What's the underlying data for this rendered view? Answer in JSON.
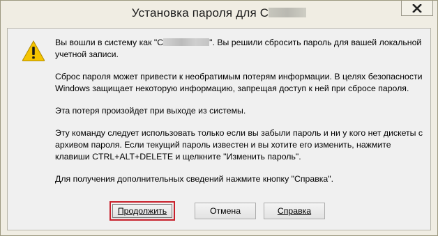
{
  "window": {
    "title": "Установка пароля для С"
  },
  "message": {
    "p1_before": "Вы вошли в систему как \"С",
    "p1_after": "\". Вы решили сбросить пароль для вашей локальной учетной записи.",
    "p2": "Сброс пароля может привести к необратимым потерям информации. В целях безопасности Windows защищает некоторую информацию, запрещая доступ к ней при сбросе пароля.",
    "p3": "Эта потеря произойдет при выходе из системы.",
    "p4": "Эту команду следует использовать только если вы забыли пароль и ни у кого нет дискеты с архивом пароля. Если текущий пароль известен и вы хотите его изменить, нажмите клавиши CTRL+ALT+DELETE и щелкните \"Изменить пароль\".",
    "p5": "Для получения дополнительных сведений нажмите кнопку \"Справка\"."
  },
  "buttons": {
    "continue_label": "Продолжить",
    "cancel_label": "Отмена",
    "help_label": "Справка"
  },
  "icons": {
    "warning": "warning-icon",
    "close": "close-icon"
  },
  "colors": {
    "focus_border": "#c8202b",
    "warning_fill": "#f5c400"
  }
}
